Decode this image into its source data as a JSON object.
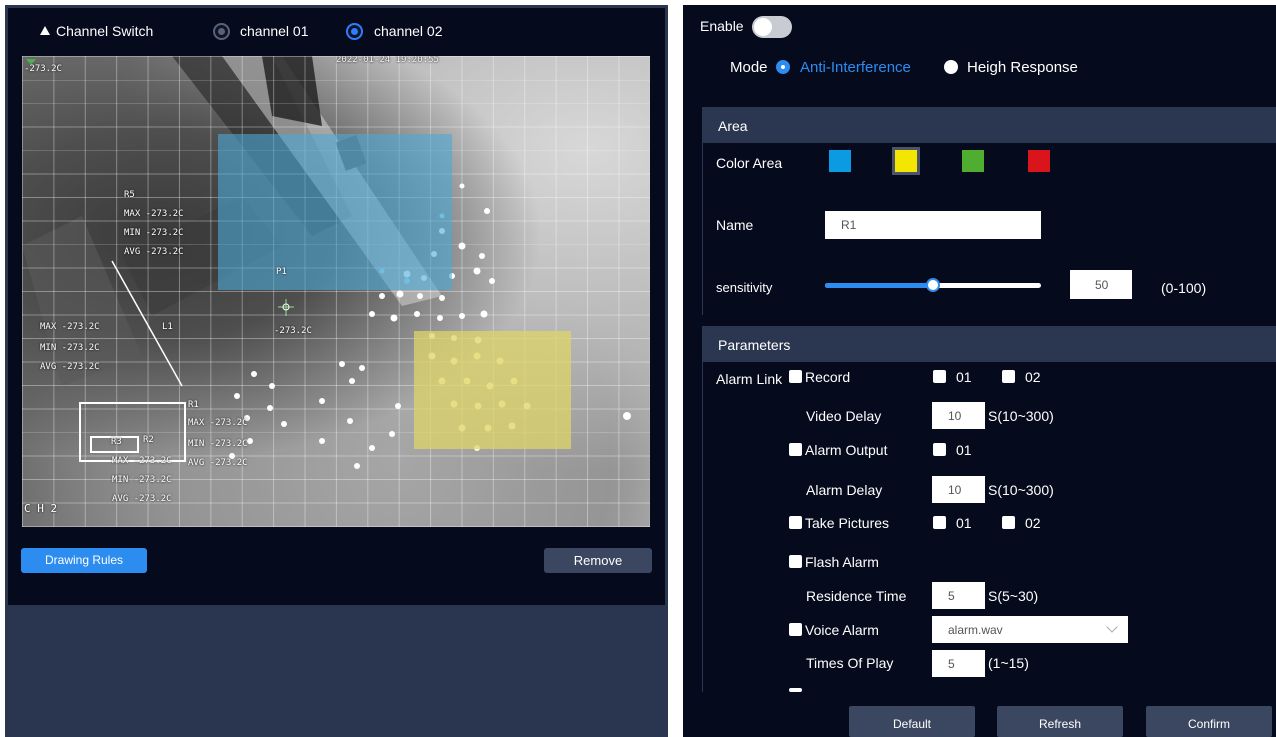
{
  "channel_switch": {
    "label": "Channel Switch",
    "options": [
      "channel 01",
      "channel 02"
    ],
    "selected": "channel 02"
  },
  "video": {
    "timestamp": "2022-01-24 19:20:55",
    "channel_label": "C H 2",
    "corner_temp": "-273.2C",
    "overlays": {
      "r5": {
        "name": "R5",
        "max": "MAX -273.2C",
        "min": "MIN -273.2C",
        "avg": "AVG -273.2C"
      },
      "l1": {
        "name": "L1",
        "max": "MAX -273.2C",
        "min": "MIN -273.2C",
        "avg": "AVG -273.2C"
      },
      "p1": {
        "name": "P1",
        "temp": "-273.2C"
      },
      "r1": {
        "name": "R1",
        "max": "MAX -273.2C",
        "min": "MIN -273.2C",
        "avg": "AVG -273.2C"
      },
      "r2": {
        "name": "R2",
        "max": "MAX -273.2C",
        "min": "MIN -273.2C",
        "avg": "AVG -273.2C"
      },
      "r3": {
        "name": "R3"
      }
    }
  },
  "left_buttons": {
    "drawing_rules": "Drawing Rules",
    "remove": "Remove"
  },
  "enable": {
    "label": "Enable",
    "on": false
  },
  "mode": {
    "label": "Mode",
    "options": [
      "Anti-Interference",
      "Heigh Response"
    ],
    "selected": "Anti-Interference"
  },
  "area": {
    "title": "Area",
    "color_label": "Color Area",
    "colors": [
      "#0b9be3",
      "#f4e603",
      "#4fae2f",
      "#d9141b"
    ],
    "selected_color": "#f4e603",
    "name_label": "Name",
    "name_value": "R1",
    "sensitivity_label": "sensitivity",
    "sensitivity_value": "50",
    "sensitivity_range": "(0-100)",
    "sensitivity_level": 0.5
  },
  "parameters": {
    "title": "Parameters",
    "alarm_link_label": "Alarm Link",
    "record": {
      "label": "Record",
      "options": [
        "01",
        "02"
      ]
    },
    "video_delay": {
      "label": "Video Delay",
      "value": "10",
      "range": "S(10~300)"
    },
    "alarm_output": {
      "label": "Alarm Output",
      "options": [
        "01"
      ]
    },
    "alarm_delay": {
      "label": "Alarm Delay",
      "value": "10",
      "range": "S(10~300)"
    },
    "take_pictures": {
      "label": "Take Pictures",
      "options": [
        "01",
        "02"
      ]
    },
    "flash_alarm": {
      "label": "Flash Alarm"
    },
    "residence_time": {
      "label": "Residence Time",
      "value": "5",
      "range": "S(5~30)"
    },
    "voice_alarm": {
      "label": "Voice Alarm",
      "selected": "alarm.wav"
    },
    "times_of_play": {
      "label": "Times Of Play",
      "value": "5",
      "range": "(1~15)"
    }
  },
  "footer": {
    "default": "Default",
    "refresh": "Refresh",
    "confirm": "Confirm"
  }
}
